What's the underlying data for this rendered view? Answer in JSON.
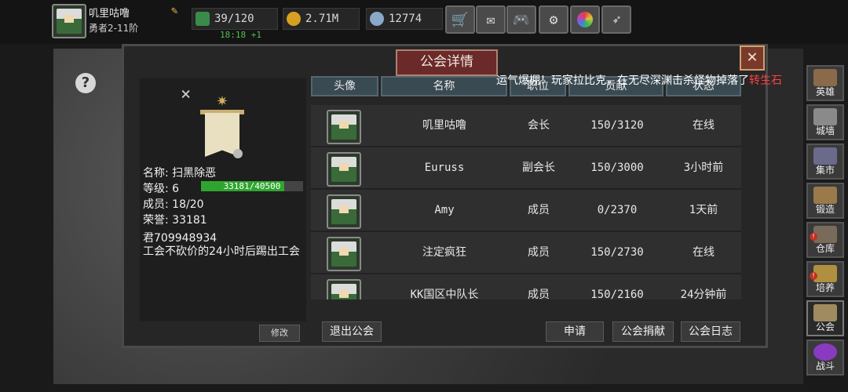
{
  "player": {
    "name": "叽里咕噜",
    "rank": "勇者2-11阶"
  },
  "resources": {
    "energy": "39/120",
    "energy_timer": "18:18 +1",
    "gold": "2.71M",
    "gems": "12774"
  },
  "top_buttons": [
    "cart-icon",
    "mail-icon",
    "gamepad-icon",
    "gear-icon",
    "color-wheel-icon",
    "feather-icon"
  ],
  "dialog": {
    "title": "公会详情",
    "close": "✕",
    "ticker": {
      "text": "运气爆棚！玩家拉比克，在无尽深渊击杀怪物掉落了",
      "highlight": "转生石"
    }
  },
  "guild": {
    "name_label": "名称:",
    "name": "扫黑除恶",
    "level_label": "等级:",
    "level": "6",
    "xp": "33181/40500",
    "xp_progress": 0.819,
    "members_label": "成员:",
    "members": "18/20",
    "honor_label": "荣誉:",
    "honor": "33181",
    "notice": "君709948934\n工会不砍价的24小时后踢出工会",
    "edit_button": "修改"
  },
  "table": {
    "headers": [
      "头像",
      "名称",
      "职位",
      "贡献",
      "状态"
    ],
    "rows": [
      {
        "name": "叽里咕噜",
        "position": "会长",
        "contribution": "150/3120",
        "status": "在线",
        "online": true
      },
      {
        "name": "Euruss",
        "position": "副会长",
        "contribution": "150/3000",
        "status": "3小时前",
        "online": false
      },
      {
        "name": "Amy",
        "position": "成员",
        "contribution": "0/2370",
        "status": "1天前",
        "online": false
      },
      {
        "name": "注定疯狂",
        "position": "成员",
        "contribution": "150/2730",
        "status": "在线",
        "online": true
      },
      {
        "name": "KK国区中队长",
        "position": "成员",
        "contribution": "150/2160",
        "status": "24分钟前",
        "online": false
      }
    ]
  },
  "footer": {
    "leave": "退出公会",
    "apply": "申请",
    "donate": "公会捐献",
    "log": "公会日志"
  },
  "sidebar": [
    {
      "label": "英雄",
      "icon": "hero-icon",
      "color": "#8a6a4a"
    },
    {
      "label": "城墙",
      "icon": "wall-icon",
      "color": "#8a8a8a"
    },
    {
      "label": "集市",
      "icon": "market-icon",
      "color": "#6a6a8a"
    },
    {
      "label": "锻造",
      "icon": "anvil-icon",
      "color": "#9a7a4a"
    },
    {
      "label": "仓库",
      "icon": "warehouse-icon",
      "color": "#7a6a5a"
    },
    {
      "label": "培养",
      "icon": "trophy-icon",
      "color": "#b09040"
    },
    {
      "label": "公会",
      "icon": "guild-icon",
      "color": "#a08a60"
    },
    {
      "label": "战斗",
      "icon": "portal-icon",
      "color": "#8a3ac0"
    }
  ]
}
